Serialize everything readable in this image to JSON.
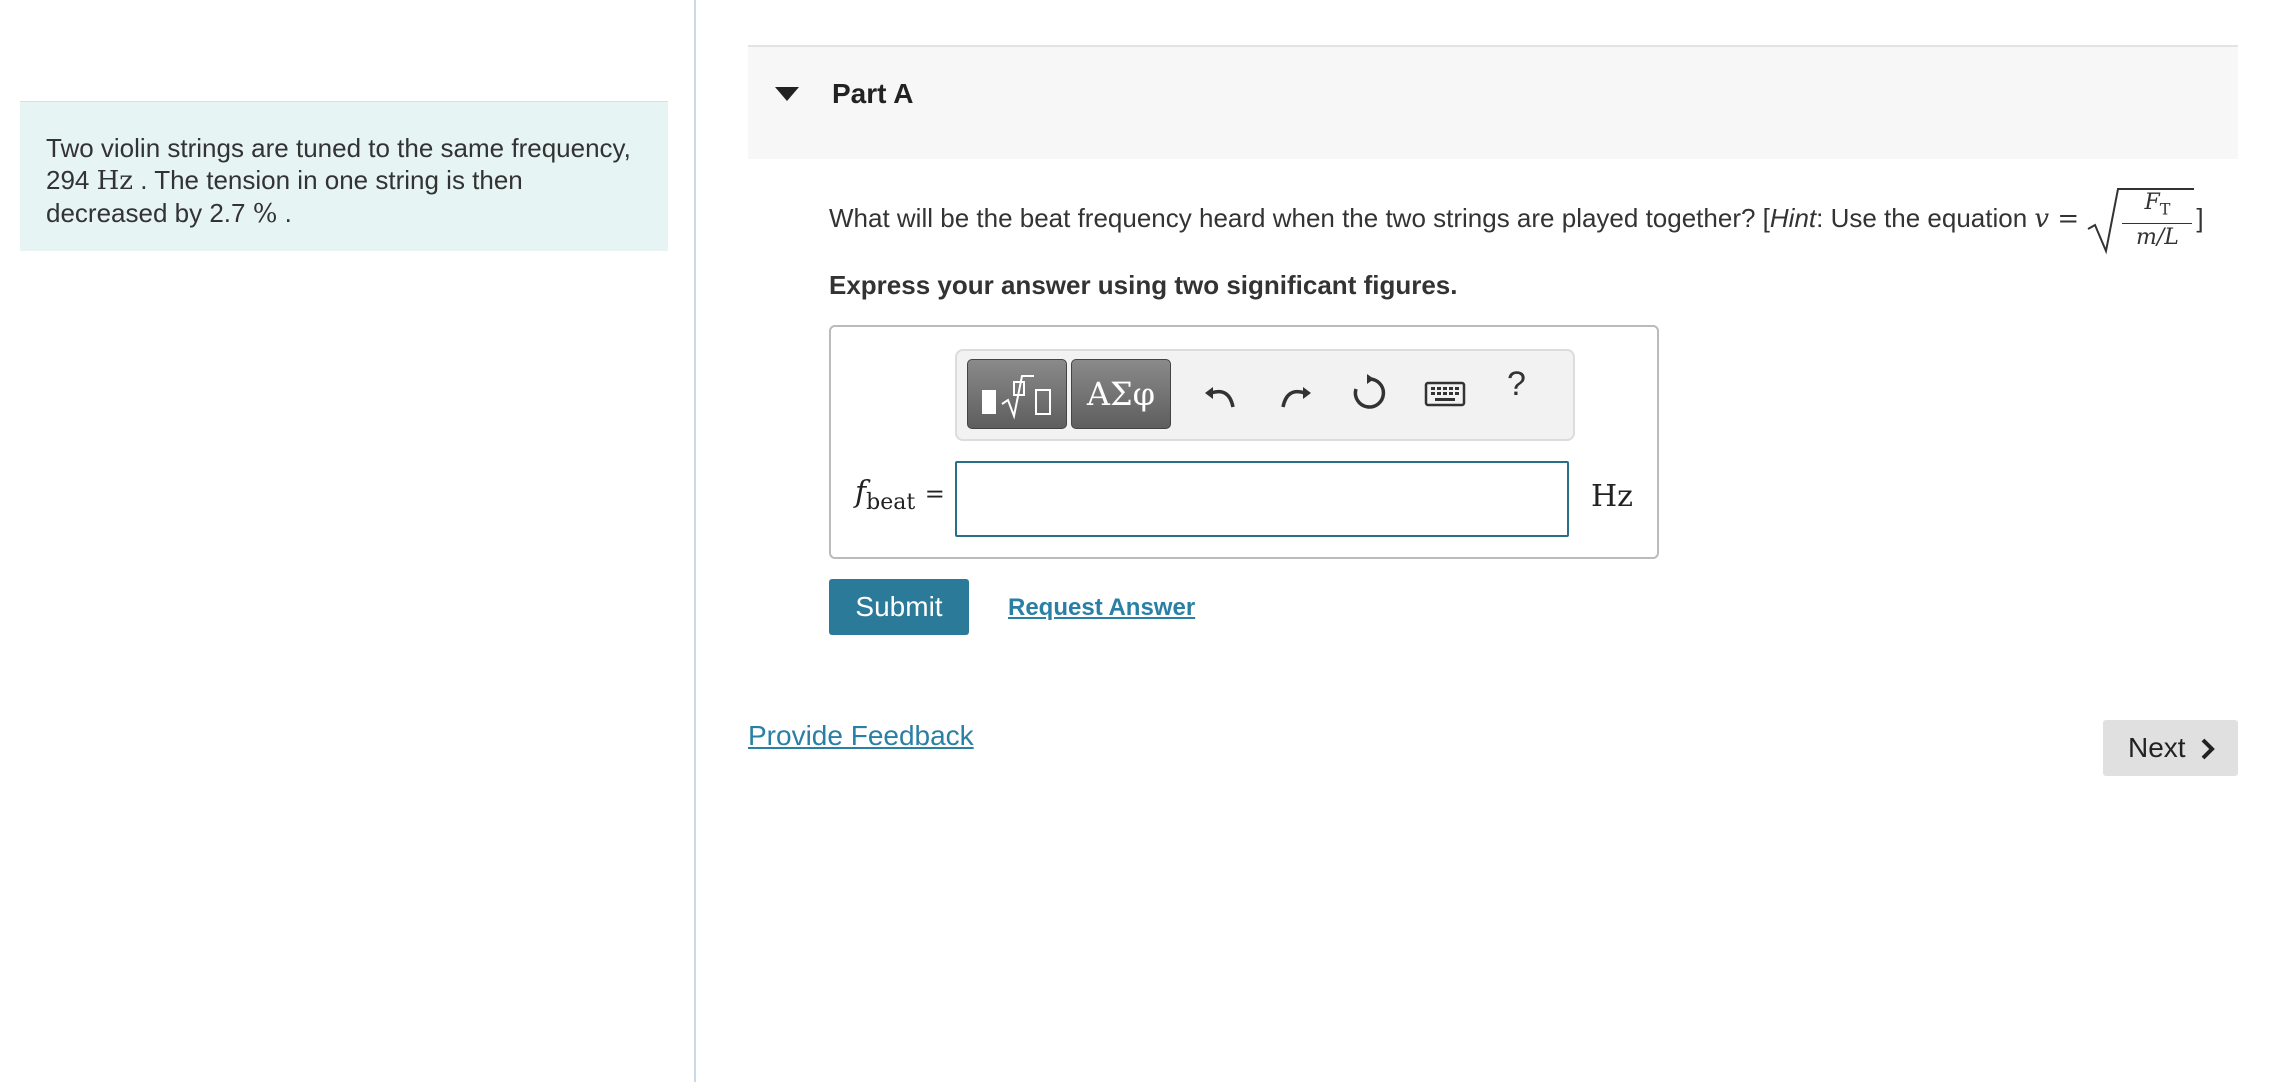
{
  "problem": {
    "line1": "Two violin strings are tuned to the same frequency,",
    "freq_value": "294",
    "freq_unit": "Hz",
    "line2_rest": ". The tension in one string is then",
    "line3_pre": "decreased by 2.7",
    "percent": "%",
    "line3_post": "."
  },
  "part": {
    "title": "Part A",
    "icon": "caret-down-icon"
  },
  "question": {
    "text": "What will be the beat frequency heard when the two strings are played together? [",
    "hint_label": "Hint",
    "hint_text": ": Use the equation",
    "eq_lhs": "v =",
    "frac_num": "F",
    "frac_num_sub": "T",
    "frac_den": "m/L",
    "close": "]"
  },
  "instruction": "Express your answer using two significant figures.",
  "toolbar": {
    "templates_icon": "templates-icon",
    "symbols_label": "ΑΣφ",
    "undo_icon": "undo-icon",
    "redo_icon": "redo-icon",
    "reset_icon": "reset-icon",
    "keyboard_icon": "keyboard-icon",
    "help_label": "?"
  },
  "answer": {
    "var": "f",
    "var_sub": "beat",
    "equals": "=",
    "value": "",
    "unit": "Hz"
  },
  "actions": {
    "submit_label": "Submit",
    "request_label": "Request Answer"
  },
  "footer": {
    "feedback_label": "Provide Feedback",
    "next_label": "Next"
  }
}
